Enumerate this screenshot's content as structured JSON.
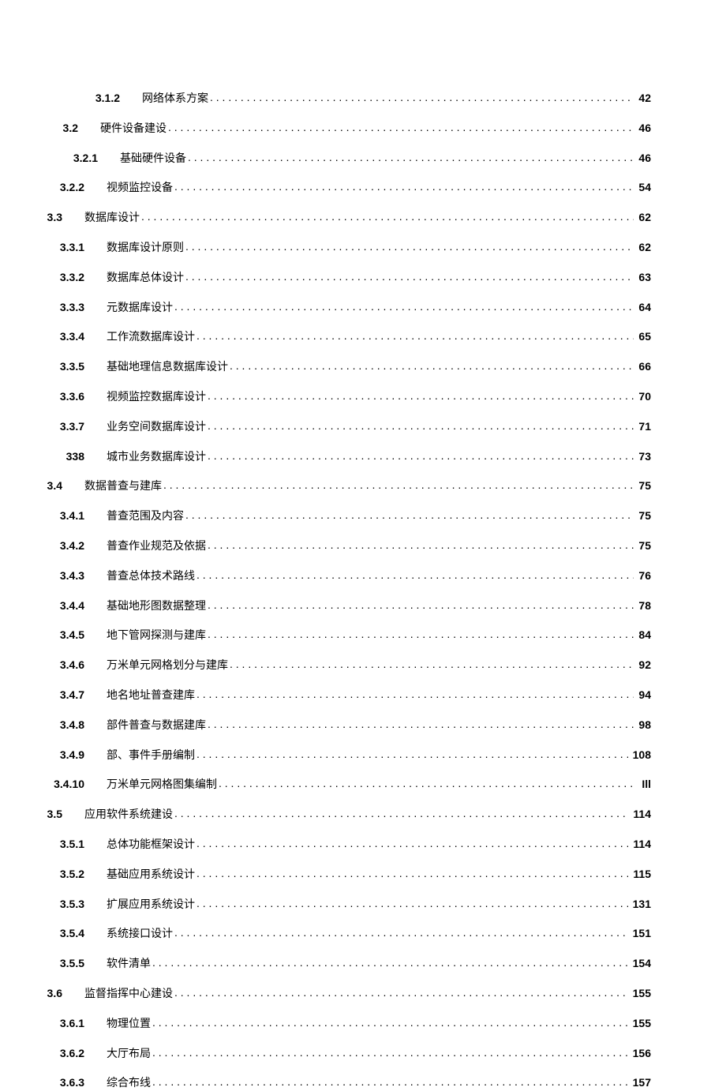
{
  "toc": {
    "entries": [
      {
        "number": "3.1.2",
        "title": "网络体系方案",
        "page": "42",
        "level": "sub2"
      },
      {
        "number": "3.2",
        "title": "硬件设备建设",
        "page": "46",
        "level": "sec"
      },
      {
        "number": "3.2.1",
        "title": "基础硬件设备",
        "page": "46",
        "level": "sub"
      },
      {
        "number": "3.2.2",
        "title": "视频监控设备",
        "page": "54",
        "level": "subl"
      },
      {
        "number": "3.3",
        "title": "数据库设计",
        "page": "62",
        "level": "secl"
      },
      {
        "number": "3.3.1",
        "title": "数据库设计原则",
        "page": "62",
        "level": "subl"
      },
      {
        "number": "3.3.2",
        "title": "数据库总体设计",
        "page": "63",
        "level": "subl"
      },
      {
        "number": "3.3.3",
        "title": "元数据库设计",
        "page": "64",
        "level": "subl"
      },
      {
        "number": "3.3.4",
        "title": "工作流数据库设计",
        "page": "65",
        "level": "subl"
      },
      {
        "number": "3.3.5",
        "title": "基础地理信息数据库设计",
        "page": "66",
        "level": "subl"
      },
      {
        "number": "3.3.6",
        "title": "视频监控数据库设计",
        "page": "70",
        "level": "subl"
      },
      {
        "number": "3.3.7",
        "title": "业务空间数据库设计",
        "page": "71",
        "level": "subl"
      },
      {
        "number": "338",
        "title": "城市业务数据库设计",
        "page": "73",
        "level": "subl"
      },
      {
        "number": "3.4",
        "title": "数据普查与建库",
        "page": "75",
        "level": "secl"
      },
      {
        "number": "3.4.1",
        "title": "普查范围及内容",
        "page": "75",
        "level": "subl"
      },
      {
        "number": "3.4.2",
        "title": "普查作业规范及依据",
        "page": "75",
        "level": "subl"
      },
      {
        "number": "3.4.3",
        "title": "普查总体技术路线",
        "page": "76",
        "level": "subl"
      },
      {
        "number": "3.4.4",
        "title": "基础地形图数据整理",
        "page": "78",
        "level": "subl"
      },
      {
        "number": "3.4.5",
        "title": "地下管网探测与建库",
        "page": "84",
        "level": "subl"
      },
      {
        "number": "3.4.6",
        "title": "万米单元网格划分与建库",
        "page": "92",
        "level": "subl"
      },
      {
        "number": "3.4.7",
        "title": "地名地址普查建库",
        "page": "94",
        "level": "subl"
      },
      {
        "number": "3.4.8",
        "title": "部件普查与数据建库",
        "page": "98",
        "level": "subl"
      },
      {
        "number": "3.4.9",
        "title": "部、事件手册编制",
        "page": "108",
        "level": "subl"
      },
      {
        "number": "3.4.10",
        "title": "万米单元网格图集编制",
        "page": "Ill",
        "level": "subl"
      },
      {
        "number": "3.5",
        "title": "应用软件系统建设",
        "page": "114",
        "level": "secl"
      },
      {
        "number": "3.5.1",
        "title": "总体功能框架设计",
        "page": "114",
        "level": "subl"
      },
      {
        "number": "3.5.2",
        "title": "基础应用系统设计",
        "page": "115",
        "level": "subl"
      },
      {
        "number": "3.5.3",
        "title": "扩展应用系统设计",
        "page": "131",
        "level": "subl"
      },
      {
        "number": "3.5.4",
        "title": "系统接口设计",
        "page": "151",
        "level": "subl"
      },
      {
        "number": "3.5.5",
        "title": "软件清单",
        "page": "154",
        "level": "subl"
      },
      {
        "number": "3.6",
        "title": "监督指挥中心建设",
        "page": "155",
        "level": "secl"
      },
      {
        "number": "3.6.1",
        "title": "物理位置",
        "page": "155",
        "level": "subl"
      },
      {
        "number": "3.6.2",
        "title": "大厅布局",
        "page": "156",
        "level": "subl"
      },
      {
        "number": "3.6.3",
        "title": "综合布线",
        "page": "157",
        "level": "subl"
      }
    ]
  }
}
